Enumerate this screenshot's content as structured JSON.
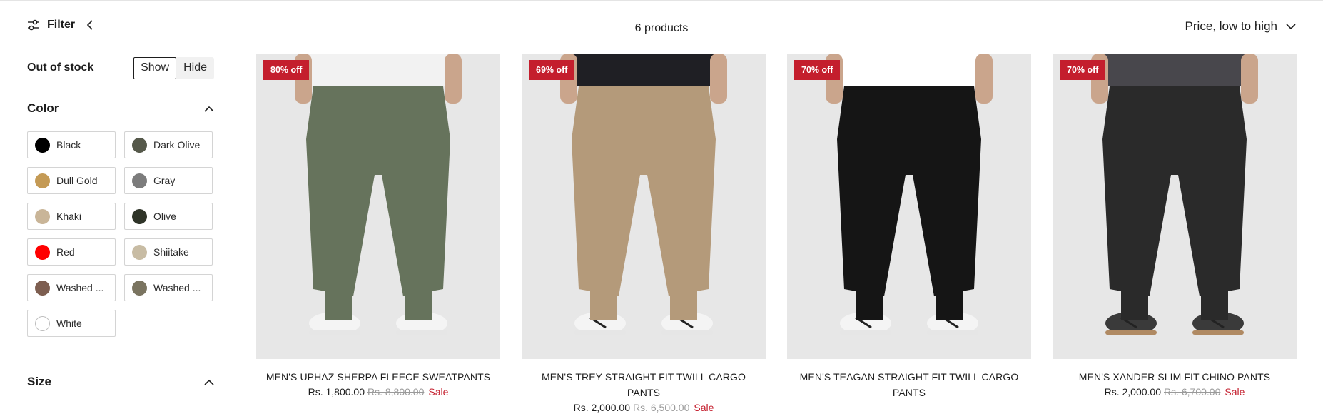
{
  "toolbar": {
    "filter_label": "Filter",
    "product_count": "6 products",
    "sort_label": "Price, low to high"
  },
  "sidebar": {
    "stock": {
      "title": "Out of stock",
      "options": [
        "Show",
        "Hide"
      ],
      "selected": "Show"
    },
    "color": {
      "title": "Color",
      "swatches": [
        {
          "name": "Black",
          "hex": "#000000"
        },
        {
          "name": "Dark Olive",
          "hex": "#56594b"
        },
        {
          "name": "Dull Gold",
          "hex": "#c49a55"
        },
        {
          "name": "Gray",
          "hex": "#7c7c7c"
        },
        {
          "name": "Khaki",
          "hex": "#c9b598"
        },
        {
          "name": "Olive",
          "hex": "#2f3428"
        },
        {
          "name": "Red",
          "hex": "#ff0000"
        },
        {
          "name": "Shiitake",
          "hex": "#c8bca4"
        },
        {
          "name": "Washed ...",
          "hex": "#7d5e50"
        },
        {
          "name": "Washed ...",
          "hex": "#7a7460"
        },
        {
          "name": "White",
          "hex": "#ffffff"
        }
      ]
    },
    "size": {
      "title": "Size"
    }
  },
  "products": [
    {
      "badge": "80% off",
      "title": "MEN'S UPHAZ SHERPA FLEECE SWEATPANTS",
      "price": "Rs. 1,800.00",
      "compare_price": "Rs. 8,800.00",
      "sale_label": "Sale",
      "pant_color": "#66735c",
      "shirt_color": "#f2f2f2"
    },
    {
      "badge": "69% off",
      "title": "MEN'S TREY STRAIGHT FIT TWILL CARGO PANTS",
      "price": "Rs. 2,000.00",
      "compare_price": "Rs. 6,500.00",
      "sale_label": "Sale",
      "pant_color": "#b49a7a",
      "shirt_color": "#1f1f24"
    },
    {
      "badge": "70% off",
      "title": "MEN'S TEAGAN STRAIGHT FIT TWILL CARGO PANTS",
      "price": "",
      "compare_price": "",
      "sale_label": "",
      "pant_color": "#151515",
      "shirt_color": "#ffffff"
    },
    {
      "badge": "70% off",
      "title": "MEN'S XANDER SLIM FIT CHINO PANTS",
      "price": "Rs. 2,000.00",
      "compare_price": "Rs. 6,700.00",
      "sale_label": "Sale",
      "pant_color": "#2a2a2a",
      "shirt_color": "#48474c"
    }
  ],
  "colors": {
    "accent_red": "#c41e2d",
    "text": "#1d1d1d",
    "muted": "#9a9a9a"
  }
}
